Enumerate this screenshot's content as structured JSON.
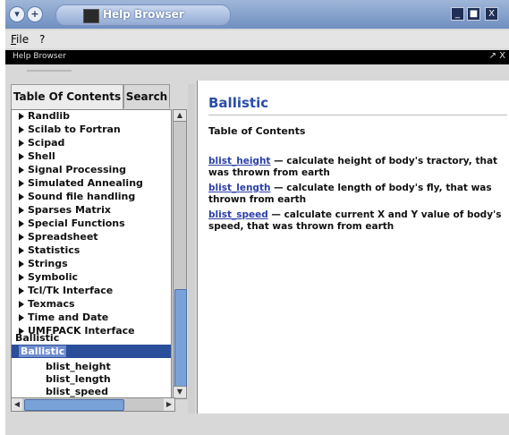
{
  "window": {
    "title": "Help Browser",
    "buttons": [
      "_",
      "■",
      "X"
    ]
  },
  "menu": {
    "items": [
      {
        "label": "File",
        "underline": "F",
        "rest": "ile"
      },
      {
        "label": "?"
      }
    ]
  },
  "strip": {
    "label": "Help Browser",
    "controls": "↗ X"
  },
  "tabs": [
    "Table Of Contents",
    "Search"
  ],
  "tree": {
    "items": [
      "Randlib",
      "Scilab to Fortran",
      "Scipad",
      "Shell",
      "Signal Processing",
      "Simulated Annealing",
      "Sound file handling",
      "Sparses Matrix",
      "Special Functions",
      "Spreadsheet",
      "Statistics",
      "Strings",
      "Symbolic",
      "Tcl/Tk Interface",
      "Texmacs",
      "Time and Date",
      "UMFPACK Interface"
    ],
    "plain_item": "Ballistic",
    "selected": "Ballistic",
    "children": [
      "blist_height",
      "blist_length",
      "blist_speed"
    ]
  },
  "content": {
    "title": "Ballistic",
    "subtitle": "Table of Contents",
    "entries": [
      {
        "link": "blist_height",
        "text": " — calculate height of body's tractory, that was thrown from earth"
      },
      {
        "link": "blist_length",
        "text": " — calculate length of body's fly, that was thrown from earth"
      },
      {
        "link": "blist_speed",
        "text": " — calculate current X and Y value of body's speed, that was thrown from earth"
      }
    ]
  },
  "colors": {
    "title_bar": "#7f9ccb",
    "link": "#2b3fa8",
    "heading": "#2b4ea5",
    "selection": "#2b4e9a"
  }
}
